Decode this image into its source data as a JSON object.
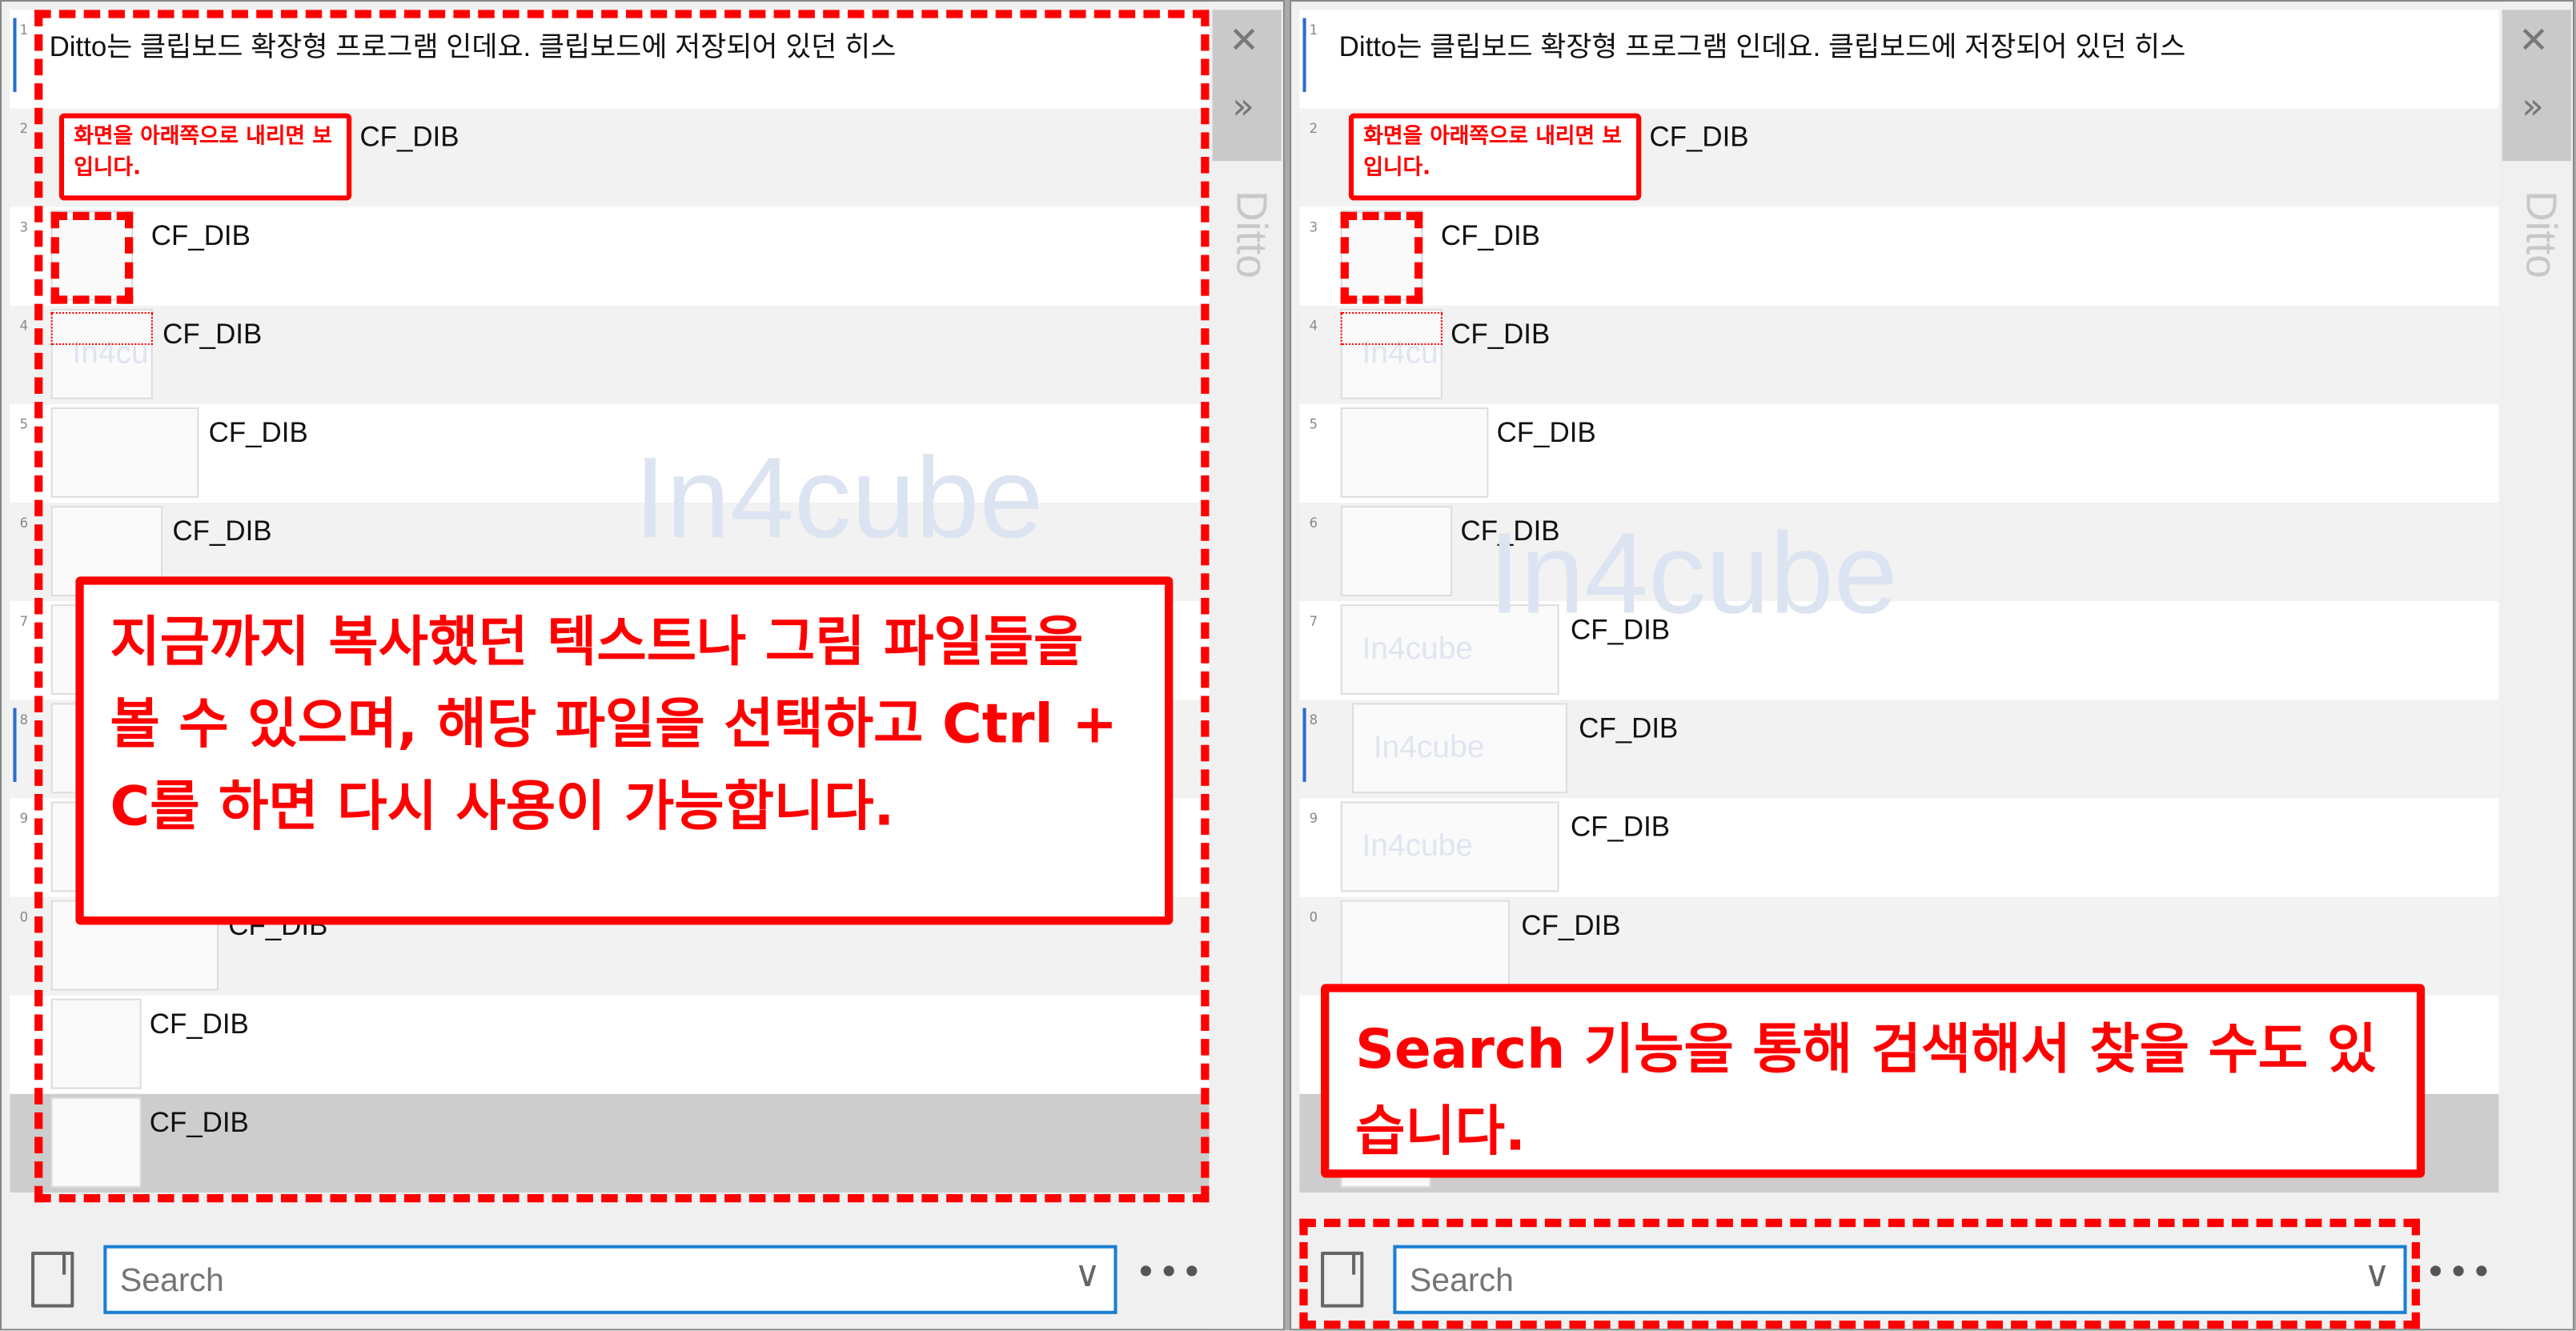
{
  "watermark": "In4cube",
  "colors": {
    "annotation": "#ff0000",
    "accent": "#1a7fd4",
    "selected_row": "#cdcdcd"
  },
  "sidebar": {
    "close_icon": "close-icon",
    "expand_icon": "chevron-double-right-icon",
    "vertical_title": "Ditto"
  },
  "list": {
    "rows": [
      {
        "num": "1",
        "text": "Ditto는 클립보드 확장형 프로그램 인데요. 클립보드에 저장되어 있던 히스"
      },
      {
        "num": "2",
        "text": "CF_DIB"
      },
      {
        "num": "3",
        "text": "CF_DIB"
      },
      {
        "num": "4",
        "text": "CF_DIB"
      },
      {
        "num": "5",
        "text": "CF_DIB"
      },
      {
        "num": "6",
        "text": "CF_DIB"
      },
      {
        "num": "7",
        "text": "CF_DIB"
      },
      {
        "num": "8",
        "text": "CF_DIB"
      },
      {
        "num": "9",
        "text": "CF_DIB"
      },
      {
        "num": "0",
        "text": "CF_DIB"
      },
      {
        "num": "",
        "text": "CF_DIB"
      },
      {
        "num": "",
        "text": "CF_DIB"
      }
    ],
    "selected_index": 11
  },
  "bottom": {
    "search_placeholder": "Search",
    "more_label": "•••",
    "dropdown_icon": "chevron-down-icon",
    "left_icon": "sticky-note-icon"
  },
  "annotations": {
    "scroll_hint": "화면을 아래쪽으로 내리면 보입니다.",
    "left_main": "지금까지 복사했던 텍스트나 그림 파일들을 볼 수 있으며, 해당 파일을 선택하고 Ctrl + C를 하면 다시 사용이 가능합니다.",
    "right_main": "Search 기능을 통해 검색해서 찾을 수도 있습니다."
  }
}
